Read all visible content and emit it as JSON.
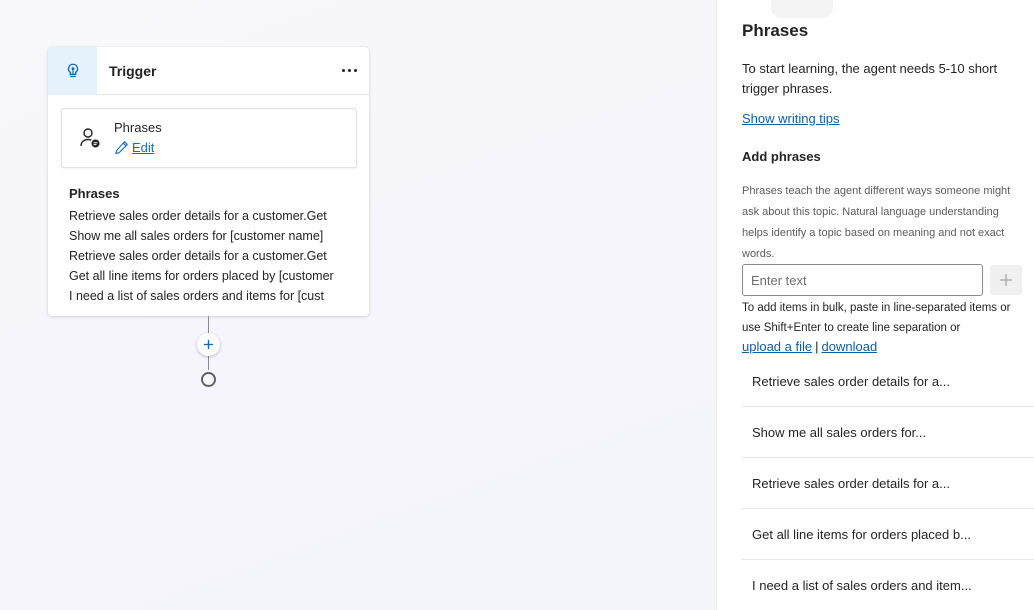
{
  "canvas": {
    "trigger_card": {
      "icon": "lightbulb-icon",
      "title": "Trigger",
      "more_icon": "more-horizontal-icon",
      "phrases_box": {
        "icon": "person-chat-icon",
        "title": "Phrases",
        "edit_icon": "pencil-icon",
        "edit_label": "Edit"
      },
      "preview": {
        "label": "Phrases",
        "lines": [
          "Retrieve sales order details for a customer.Get",
          "Show me all sales orders for [customer name]",
          "Retrieve sales order details for a customer.Get",
          "Get all line items for orders placed by [customer",
          "I need a list of sales orders and items for [cust"
        ]
      }
    },
    "add_node_icon": "plus-icon",
    "end_node_icon": "circle-icon"
  },
  "panel": {
    "title": "Phrases",
    "description": "To start learning, the agent needs 5-10 short trigger phrases.",
    "tips_link": "Show writing tips",
    "add_heading": "Add phrases",
    "add_help": "Phrases teach the agent different ways someone might ask about this topic. Natural language understanding helps identify a topic based on meaning and not exact words.",
    "input_placeholder": "Enter text",
    "add_button_icon": "plus-icon",
    "bulk_help": "To add items in bulk, paste in line-separated items or use Shift+Enter to create line separation or",
    "upload_link": "upload a file",
    "separator": "|",
    "download_link": "download",
    "phrases": [
      "Retrieve sales order details for a...",
      "Show me all sales orders for...",
      "Retrieve sales order details for a...",
      "Get all line items for orders placed b...",
      "I need a list of sales orders and item..."
    ]
  },
  "colors": {
    "accent": "#0f6cbd",
    "link": "#115ea3",
    "icon_bg": "#e6f2fb"
  }
}
